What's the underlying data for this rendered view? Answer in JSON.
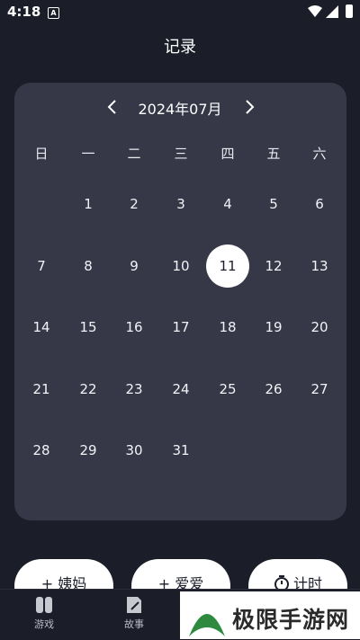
{
  "status": {
    "time": "4:18",
    "notif_icon": "A"
  },
  "header": {
    "title": "记录"
  },
  "calendar": {
    "month_label": "2024年07月",
    "weekdays": [
      "日",
      "一",
      "二",
      "三",
      "四",
      "五",
      "六"
    ],
    "days": [
      "1",
      "2",
      "3",
      "4",
      "5",
      "6",
      "7",
      "8",
      "9",
      "10",
      "11",
      "12",
      "13",
      "14",
      "15",
      "16",
      "17",
      "18",
      "19",
      "20",
      "21",
      "22",
      "23",
      "24",
      "25",
      "26",
      "27",
      "28",
      "29",
      "30",
      "31"
    ],
    "selected_day": "11"
  },
  "actions": {
    "period": "+ 姨妈",
    "love": "+ 爱爱",
    "timer": "计时"
  },
  "tabs": [
    "游戏",
    "故事"
  ],
  "watermark": {
    "text": "极限手游网"
  },
  "colors": {
    "background": "#1b1d29",
    "card": "#363847",
    "selected": "#ffffff"
  }
}
